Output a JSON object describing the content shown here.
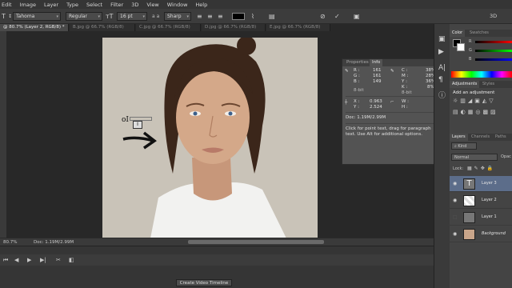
{
  "menu": [
    "Edit",
    "Image",
    "Layer",
    "Type",
    "Select",
    "Filter",
    "3D",
    "View",
    "Window",
    "Help"
  ],
  "options": {
    "font_family": "Tahoma",
    "font_style": "Regular",
    "font_size": "16 pt",
    "antialias_prefix": "a a",
    "antialias": "Sharp",
    "text_color": "#000000",
    "mode_3d": "3D"
  },
  "tabs": [
    {
      "label": "@ 80.7% (Layer 2, RGB/8) *",
      "active": true
    },
    {
      "label": "B.jpg @ 66.7% (RGB/8)",
      "active": false
    },
    {
      "label": "C.jpg @ 66.7% (RGB/8)",
      "active": false
    },
    {
      "label": "D.jpg @ 66.7% (RGB/8)",
      "active": false
    },
    {
      "label": "E.jpg @ 66.7% (RGB/8)",
      "active": false
    }
  ],
  "canvas_text": "oI",
  "info_panel": {
    "tab_properties": "Properties",
    "tab_info": "Info",
    "r_label": "R :",
    "r_value": "161",
    "g_label": "G :",
    "g_value": "161",
    "b_label": "B :",
    "b_value": "149",
    "bitdepth_left": "8-bit",
    "c_label": "C :",
    "c_value": "38%",
    "m_label": "M :",
    "m_value": "28%",
    "y_label": "Y :",
    "y_value": "36%",
    "k_label": "K :",
    "k_value": "8%",
    "bitdepth_right": "8-bit",
    "x_label": "X :",
    "x_value": "0.963",
    "yy_label": "Y :",
    "yy_value": "2.524",
    "w_label": "W :",
    "h_label": "H :",
    "doc_info": "Doc: 1.19M/2.99M",
    "help_text": "Click for point text, drag for paragraph text. Use Alt for additional options."
  },
  "status": {
    "zoom": "80.7%",
    "doc": "Doc: 1.19M/2.99M"
  },
  "timeline": {
    "create_button": "Create Video Timeline"
  },
  "right": {
    "color_tab": "Color",
    "swatches_tab": "Swatches",
    "rgb_r": "R",
    "rgb_g": "G",
    "rgb_b": "B",
    "adjustments_tab": "Adjustments",
    "styles_tab": "Styles",
    "add_adjustment": "Add an adjustment",
    "layers_tab": "Layers",
    "channels_tab": "Channels",
    "paths_tab": "Paths",
    "kind_label": "Kind",
    "blend_mode": "Normal",
    "opacity_label": "Opac",
    "lock_label": "Lock:",
    "layers": [
      {
        "name": "Layer 3",
        "type": "text",
        "visible": true,
        "selected": true
      },
      {
        "name": "Layer 2",
        "type": "empty",
        "visible": true,
        "selected": false
      },
      {
        "name": "Layer 1",
        "type": "gray",
        "visible": false,
        "selected": false
      },
      {
        "name": "Background",
        "type": "photo",
        "visible": true,
        "selected": false
      }
    ]
  },
  "colors": {
    "accent_layer": "#5c6d8a",
    "panel_bg": "#444444",
    "photo_bg": "#c9c3b8"
  }
}
